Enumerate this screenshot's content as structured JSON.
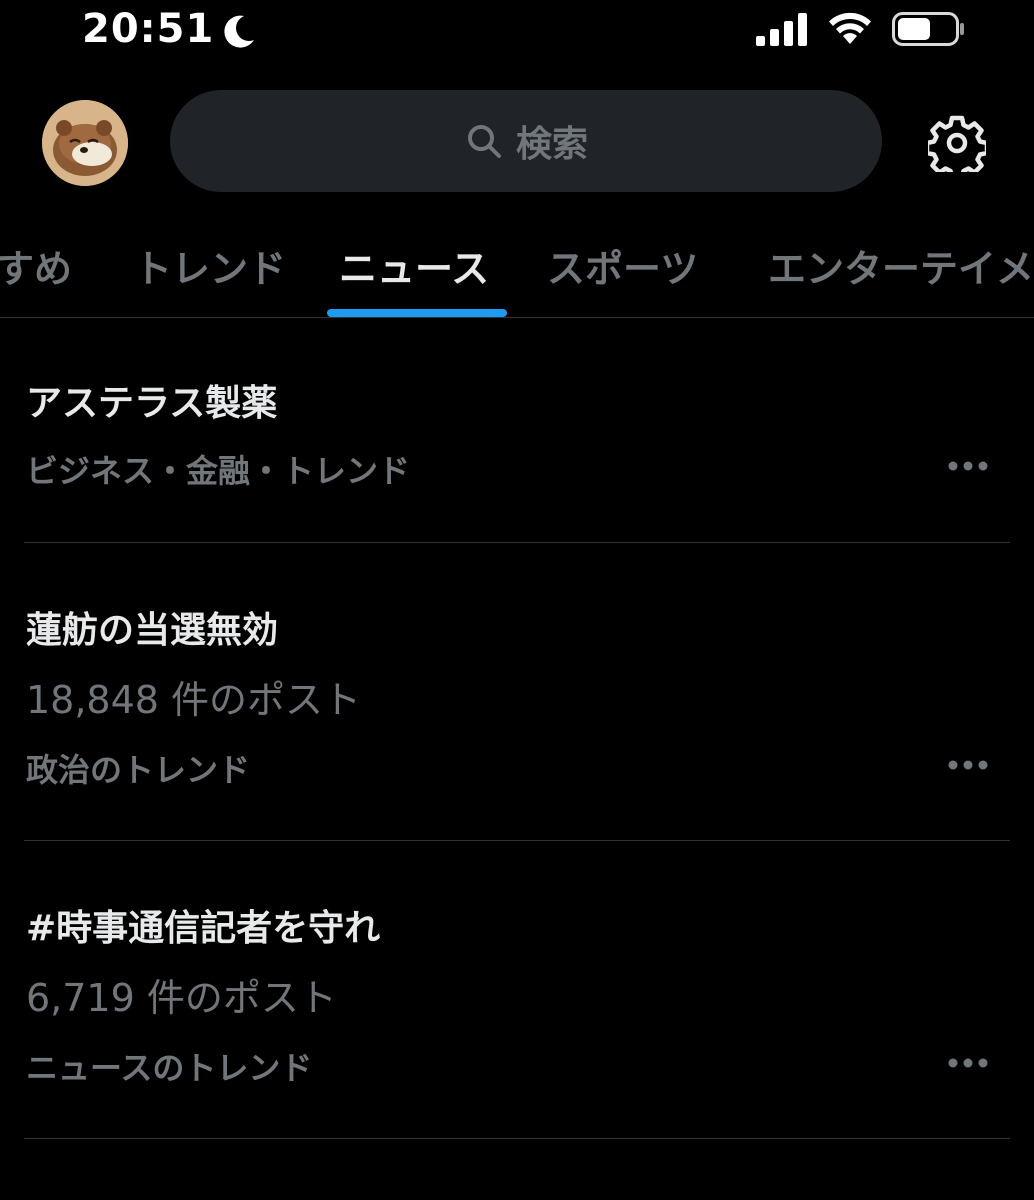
{
  "status_bar": {
    "time": "20:51"
  },
  "icons": {
    "moon": "moon-icon",
    "signal": "cellular-signal-icon",
    "wifi": "wifi-icon",
    "battery": "battery-icon",
    "search": "search-icon",
    "settings": "gear-icon",
    "more": "more-horizontal-icon"
  },
  "header": {
    "search_placeholder": "検索"
  },
  "tabs": [
    {
      "label": "すめ",
      "active": false
    },
    {
      "label": "トレンド",
      "active": false
    },
    {
      "label": "ニュース",
      "active": true
    },
    {
      "label": "スポーツ",
      "active": false
    },
    {
      "label": "エンターテイメ",
      "active": false
    }
  ],
  "trends": [
    {
      "title": "アステラス製薬",
      "context": "ビジネス・金融・トレンド"
    },
    {
      "title": "蓮舫の当選無効",
      "count": "18,848 件のポスト",
      "context": "政治のトレンド"
    },
    {
      "title": "#時事通信記者を守れ",
      "count": "6,719 件のポスト",
      "context": "ニュースのトレンド"
    }
  ],
  "colors": {
    "background": "#000000",
    "accent": "#1d9bf0",
    "text_primary": "#e7e9ea",
    "text_secondary": "#71767b",
    "search_bg": "#202327",
    "divider": "#2f3336"
  }
}
